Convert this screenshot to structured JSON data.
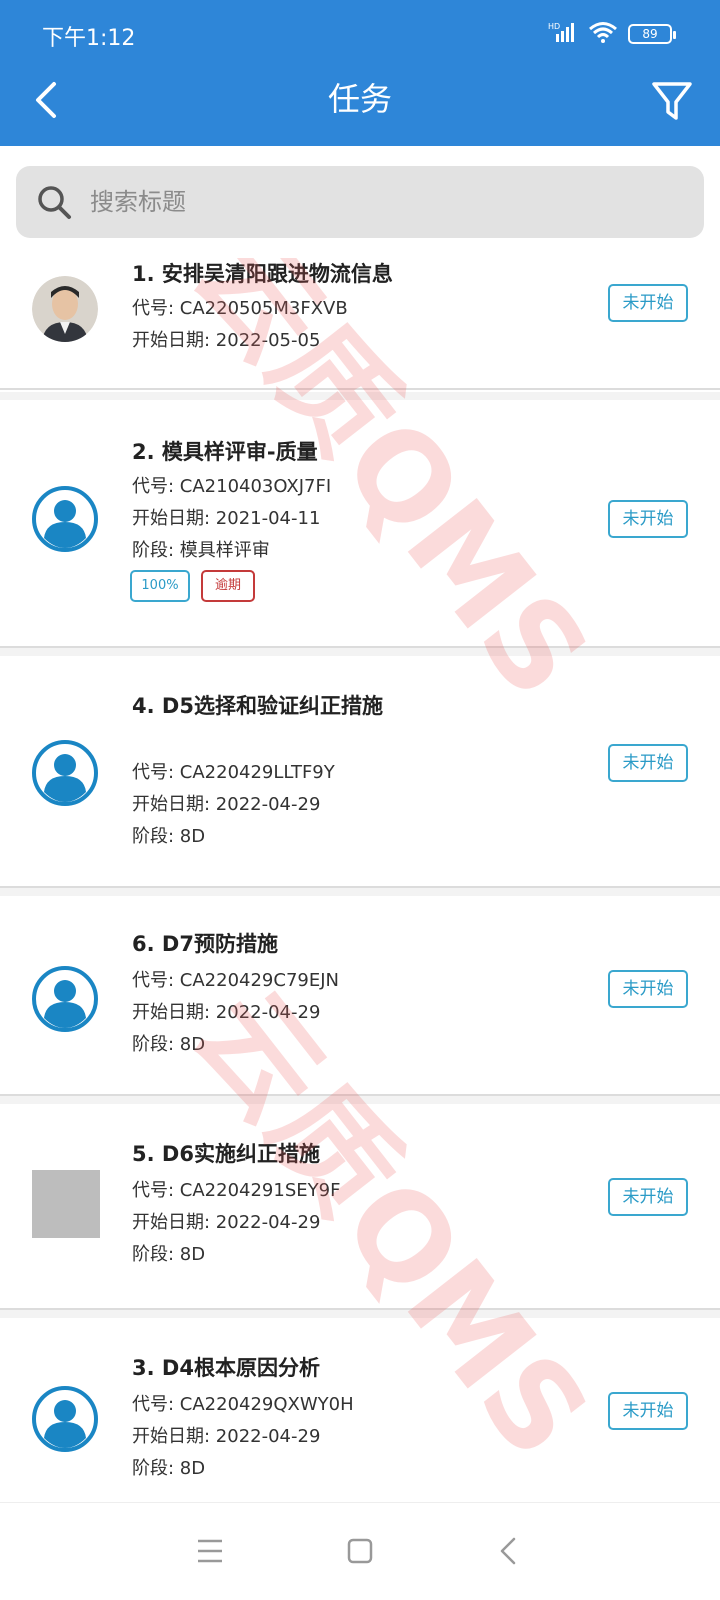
{
  "status_bar": {
    "time": "下午1:12",
    "battery": "89",
    "network": "HD"
  },
  "header": {
    "title": "任务"
  },
  "search": {
    "placeholder": "搜索标题"
  },
  "colors": {
    "primary": "#2e86d8",
    "status_border": "#3aa7cf",
    "overdue": "#c43a3a",
    "watermark": "#eb5a5a"
  },
  "watermark": "云质QMS",
  "tasks": [
    {
      "title": "1. 安排吴清阳跟进物流信息",
      "code": "代号: CA220505M3FXVB",
      "start": "开始日期: 2022-05-05",
      "status": "未开始",
      "avatar": "photo"
    },
    {
      "title": "2. 模具样评审-质量",
      "code": "代号: CA210403OXJ7FI",
      "start": "开始日期: 2021-04-11",
      "stage": "阶段:  模具样评审",
      "status": "未开始",
      "avatar": "default-user-icon",
      "tags": [
        "100%",
        "逾期"
      ]
    },
    {
      "title": "4. D5选择和验证纠正措施",
      "code": "代号: CA220429LLTF9Y",
      "start": "开始日期: 2022-04-29",
      "stage": "阶段: 8D",
      "status": "未开始",
      "avatar": "default-user-icon"
    },
    {
      "title": "6. D7预防措施",
      "code": "代号: CA220429C79EJN",
      "start": "开始日期: 2022-04-29",
      "stage": "阶段: 8D",
      "status": "未开始",
      "avatar": "default-user-icon"
    },
    {
      "title": "5. D6实施纠正措施",
      "code": "代号: CA2204291SEY9F",
      "start": "开始日期: 2022-04-29",
      "stage": "阶段: 8D",
      "status": "未开始",
      "avatar": "placeholder-image"
    },
    {
      "title": "3. D4根本原因分析",
      "code": "代号: CA220429QXWY0H",
      "start": "开始日期: 2022-04-29",
      "stage": "阶段: 8D",
      "status": "未开始",
      "avatar": "default-user-icon"
    }
  ]
}
